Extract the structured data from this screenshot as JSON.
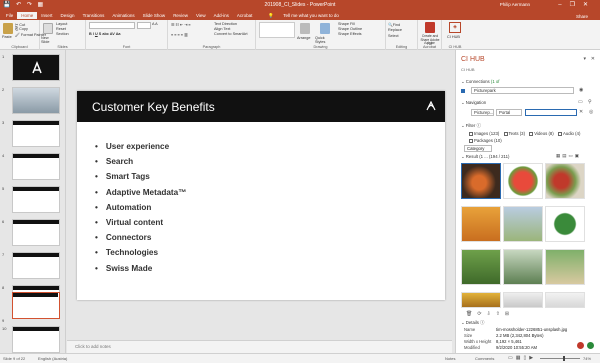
{
  "window": {
    "title": "201908_CI_Slides - PowerPoint",
    "user": "Philip Aermann",
    "controls": [
      "–",
      "❐",
      "✕"
    ]
  },
  "tabs": [
    "File",
    "Home",
    "Insert",
    "Design",
    "Transitions",
    "Animations",
    "Slide Show",
    "Review",
    "View",
    "Add-ins",
    "Acrobat"
  ],
  "tell_me": "Tell me what you want to do",
  "share": "Share",
  "ribbon": {
    "clipboard": {
      "paste": "Paste",
      "cut": "Cut",
      "copy": "Copy",
      "format_painter": "Format Painter",
      "label": "Clipboard"
    },
    "slides": {
      "new_slide": "New Slide",
      "layout": "Layout",
      "reset": "Reset",
      "section": "Section",
      "label": "Slides"
    },
    "font": {
      "label": "Font"
    },
    "paragraph": {
      "text_direction": "Text Direction",
      "align_text": "Align Text",
      "convert_smartart": "Convert to SmartArt",
      "label": "Paragraph"
    },
    "drawing": {
      "arrange": "Arrange",
      "quick_styles": "Quick Styles",
      "shape_fill": "Shape Fill",
      "shape_outline": "Shape Outline",
      "shape_effects": "Shape Effects",
      "label": "Drawing"
    },
    "editing": {
      "find": "Find",
      "replace": "Replace",
      "select": "Select",
      "label": "Editing"
    },
    "acrobat": {
      "create_share": "Create and Share Adobe PDF",
      "label": "Adobe Acrobat"
    },
    "cihub": {
      "button": "CI HUB",
      "label": "CI HUB"
    }
  },
  "thumbnails": [
    {
      "n": "1",
      "star": "",
      "selected": false
    },
    {
      "n": "2",
      "star": "",
      "selected": false
    },
    {
      "n": "3",
      "star": "",
      "selected": false
    },
    {
      "n": "4",
      "star": "★",
      "selected": false
    },
    {
      "n": "5",
      "star": "★",
      "selected": false
    },
    {
      "n": "6",
      "star": "★",
      "selected": false
    },
    {
      "n": "7",
      "star": "★",
      "selected": false
    },
    {
      "n": "8",
      "star": "★",
      "selected": false
    },
    {
      "n": "9",
      "star": "★",
      "selected": true
    },
    {
      "n": "10",
      "star": "★",
      "selected": false
    }
  ],
  "slide": {
    "title": "Customer Key Benefits",
    "bullets": [
      "User experience",
      "Search",
      "Smart Tags",
      "Adaptive Metadata™",
      "Automation",
      "Virtual content",
      "Connectors",
      "Technologies",
      "Swiss Made"
    ]
  },
  "notes_placeholder": "Click to add notes",
  "status": {
    "slide_of": "Slide 9 of 22",
    "language": "English (Austria)",
    "notes": "Notes",
    "comments": "Comments",
    "zoom": "74%"
  },
  "pane": {
    "title": "CI HUB",
    "brand": "CI HUB",
    "connections_label": "Connections",
    "connections_value": "(1 of",
    "connection_name": "Picturepark",
    "navigation_label": "Navigation",
    "nav_source": "Picturep...",
    "nav_portal": "Portal",
    "filter_label": "Filter",
    "filters": [
      "Images (123)",
      "Texts (3)",
      "Videos (8)",
      "Audio (4)",
      "Packages (10)"
    ],
    "category": "Category",
    "result_label": "Result",
    "result_count": "(1 ... (194 / 211)",
    "details_label": "Details",
    "details": [
      {
        "key": "Name",
        "value": "tim-mossholder-1226851-unsplash.jpg"
      },
      {
        "key": "Size",
        "value": "2.2 MB (2,342,804 Bytes)"
      },
      {
        "key": "Width x Height",
        "value": "8,192 × 5,461"
      },
      {
        "key": "Modified",
        "value": "9/2/2020 10:55:20 AM"
      }
    ]
  }
}
